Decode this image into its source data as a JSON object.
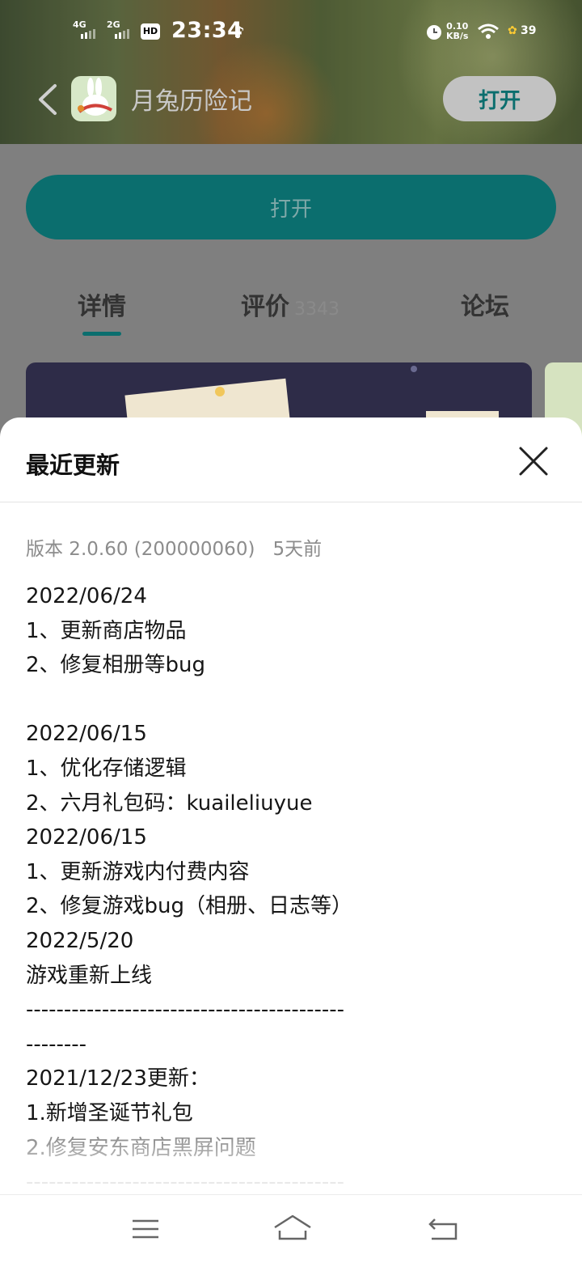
{
  "status_bar": {
    "signal1": "4G",
    "signal2": "2G",
    "hd": "HD",
    "time": "23:34",
    "speed_value": "0.10",
    "speed_unit": "KB/s",
    "battery": "39"
  },
  "app_bar": {
    "title": "月兔历险记",
    "open_label": "打开"
  },
  "main": {
    "open_button": "打开",
    "tabs": [
      {
        "label": "详情",
        "count": ""
      },
      {
        "label": "评价",
        "count": "3343"
      },
      {
        "label": "论坛",
        "count": ""
      }
    ]
  },
  "sheet": {
    "title": "最近更新",
    "version": "版本 2.0.60 (200000060)",
    "updated": "5天前",
    "lines": [
      "2022/06/24",
      "1、更新商店物品",
      "2、修复相册等bug",
      "",
      "2022/06/15",
      "1、优化存储逻辑",
      "2、六月礼包码：kuaileliuyue",
      "2022/06/15",
      "1、更新游戏内付费内容",
      "2、修复游戏bug（相册、日志等）",
      "2022/5/20",
      "游戏重新上线",
      "------------------------------------------",
      "--------",
      "2021/12/23更新：",
      "1.新增圣诞节礼包",
      "2.修复安东商店黑屏问题",
      "------------------------------------------"
    ]
  },
  "colors": {
    "accent": "#0b6e6e",
    "overlay": "#7f7f7f"
  }
}
